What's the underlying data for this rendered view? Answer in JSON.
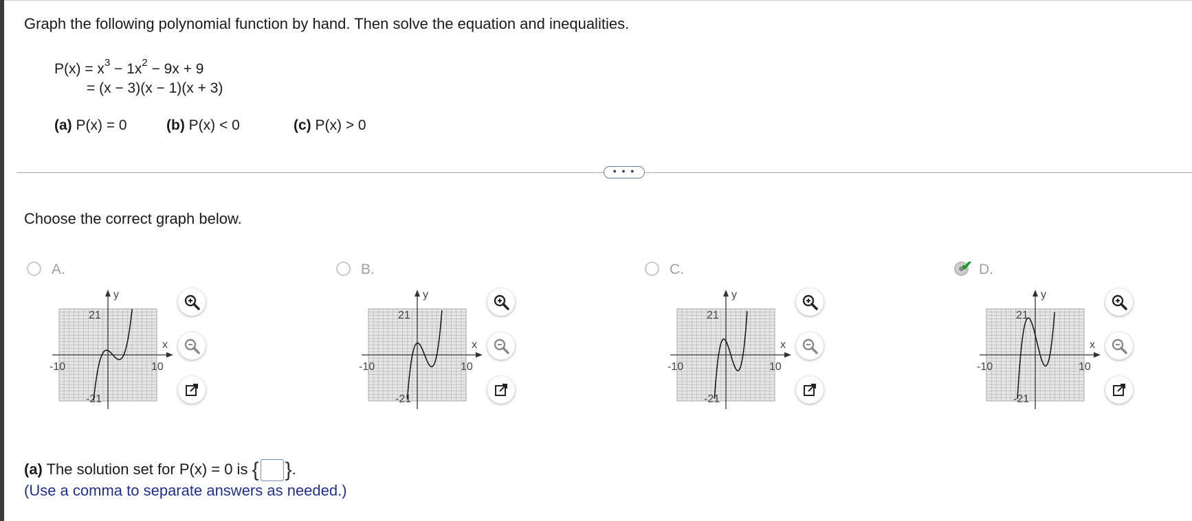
{
  "instruction": "Graph the following polynomial function by hand. Then solve the equation and inequalities.",
  "equation": {
    "line1_prefix": "P(x) = x",
    "exp3": "3",
    "line1_mid": " − 1x",
    "exp2": "2",
    "line1_suffix": " − 9x + 9",
    "line2": "= (x − 3)(x − 1)(x + 3)"
  },
  "parts": [
    {
      "label": "(a)",
      "text": " P(x) = 0"
    },
    {
      "label": "(b)",
      "text": " P(x) < 0"
    },
    {
      "label": "(c)",
      "text": " P(x) > 0"
    }
  ],
  "more_button": "• • •",
  "choose_text": "Choose the correct graph below.",
  "options": [
    {
      "label": "A.",
      "selected": false
    },
    {
      "label": "B.",
      "selected": false
    },
    {
      "label": "C.",
      "selected": false
    },
    {
      "label": "D.",
      "selected": true
    }
  ],
  "graph_labels": {
    "y_axis": "y",
    "x_axis": "x",
    "y_max": "21",
    "y_min": "-21",
    "x_min": "-10",
    "x_max": "10"
  },
  "tool_icons": [
    "zoom-in-icon",
    "zoom-out-icon",
    "open-new-window-icon"
  ],
  "question_a": {
    "label": "(a)",
    "text": " The solution set for P(x) = 0 is ",
    "brace_open": "{",
    "brace_close": "}",
    "period": "."
  },
  "hint": "(Use a comma to separate answers as needed.)",
  "colors": {
    "hint": "#1f2f8f",
    "check": "#1a9a2a",
    "accent_border": "#6f8fc7"
  }
}
